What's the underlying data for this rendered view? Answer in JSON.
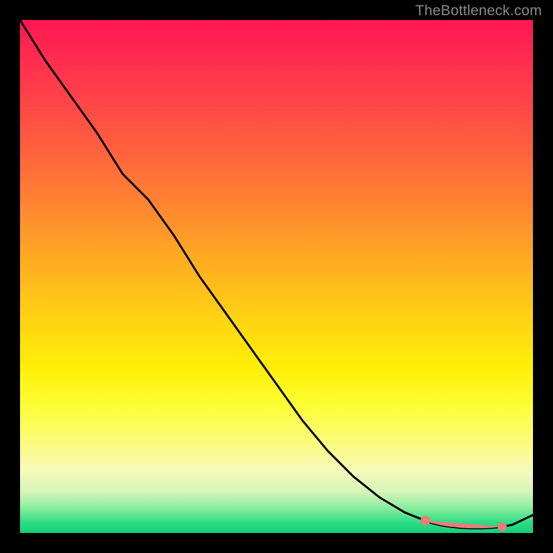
{
  "watermark": "TheBottleneck.com",
  "colors": {
    "frame_bg": "#000000",
    "watermark": "#8a8a8a",
    "line": "#000000",
    "marker": "#ef7a7a"
  },
  "chart_data": {
    "type": "line",
    "x": [
      0,
      5,
      10,
      15,
      20,
      25,
      30,
      35,
      40,
      45,
      50,
      55,
      60,
      65,
      70,
      75,
      80,
      82,
      84,
      86,
      88,
      90,
      92,
      94,
      96,
      100
    ],
    "values": [
      100,
      92,
      85,
      78,
      70,
      65,
      58,
      50,
      43,
      36,
      29,
      22,
      16,
      11,
      7,
      4,
      2,
      1.5,
      1.2,
      1.0,
      0.9,
      0.9,
      1.0,
      1.2,
      1.6,
      3.5
    ],
    "title": "",
    "xlabel": "",
    "ylabel": "",
    "xlim": [
      0,
      100
    ],
    "ylim": [
      0,
      100
    ],
    "markers": {
      "visible_range_x": [
        79,
        94
      ],
      "extra_point_x": 94
    }
  }
}
